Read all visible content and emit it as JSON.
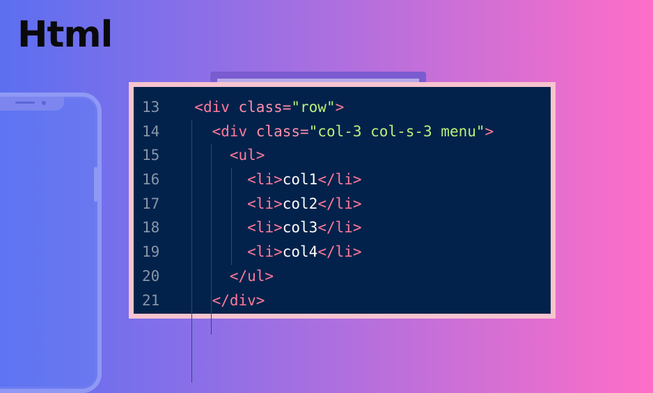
{
  "page": {
    "title": "Html"
  },
  "code": {
    "lines": [
      {
        "number": "13",
        "parts": [
          {
            "type": "tag",
            "text": "<div "
          },
          {
            "type": "attr",
            "text": "class="
          },
          {
            "type": "str",
            "text": "\"row\""
          },
          {
            "type": "tag",
            "text": ">"
          }
        ],
        "indent": 0
      },
      {
        "number": "14",
        "parts": [
          {
            "type": "tag",
            "text": "<div "
          },
          {
            "type": "attr",
            "text": "class="
          },
          {
            "type": "str",
            "text": "\"col-3 col-s-3 menu\""
          },
          {
            "type": "tag",
            "text": ">"
          }
        ],
        "indent": 1
      },
      {
        "number": "15",
        "parts": [
          {
            "type": "tag",
            "text": "<ul>"
          }
        ],
        "indent": 2
      },
      {
        "number": "16",
        "parts": [
          {
            "type": "tag",
            "text": "<li>"
          },
          {
            "type": "txt",
            "text": "col1"
          },
          {
            "type": "tag",
            "text": "</li>"
          }
        ],
        "indent": 3
      },
      {
        "number": "17",
        "parts": [
          {
            "type": "tag",
            "text": "<li>"
          },
          {
            "type": "txt",
            "text": "col2"
          },
          {
            "type": "tag",
            "text": "</li>"
          }
        ],
        "indent": 3
      },
      {
        "number": "18",
        "parts": [
          {
            "type": "tag",
            "text": "<li>"
          },
          {
            "type": "txt",
            "text": "col3"
          },
          {
            "type": "tag",
            "text": "</li>"
          }
        ],
        "indent": 3
      },
      {
        "number": "19",
        "parts": [
          {
            "type": "tag",
            "text": "<li>"
          },
          {
            "type": "txt",
            "text": "col4"
          },
          {
            "type": "tag",
            "text": "</li>"
          }
        ],
        "indent": 3
      },
      {
        "number": "20",
        "parts": [
          {
            "type": "tag",
            "text": "</ul>"
          }
        ],
        "indent": 2
      },
      {
        "number": "21",
        "parts": [
          {
            "type": "tag",
            "text": "</div>"
          }
        ],
        "indent": 1
      }
    ]
  },
  "colors": {
    "background_start": "#5b6ff0",
    "background_end": "#ff6ec7",
    "panel": "#03224b",
    "panel_border": "#f7c4cf",
    "tag": "#ff7b9c",
    "string": "#b9f07a",
    "text": "#ffffff",
    "line_number": "#8796a8"
  },
  "decorations": {
    "phone_icon": "smartphone-icon",
    "monitor_icon": "monitor-icon"
  }
}
